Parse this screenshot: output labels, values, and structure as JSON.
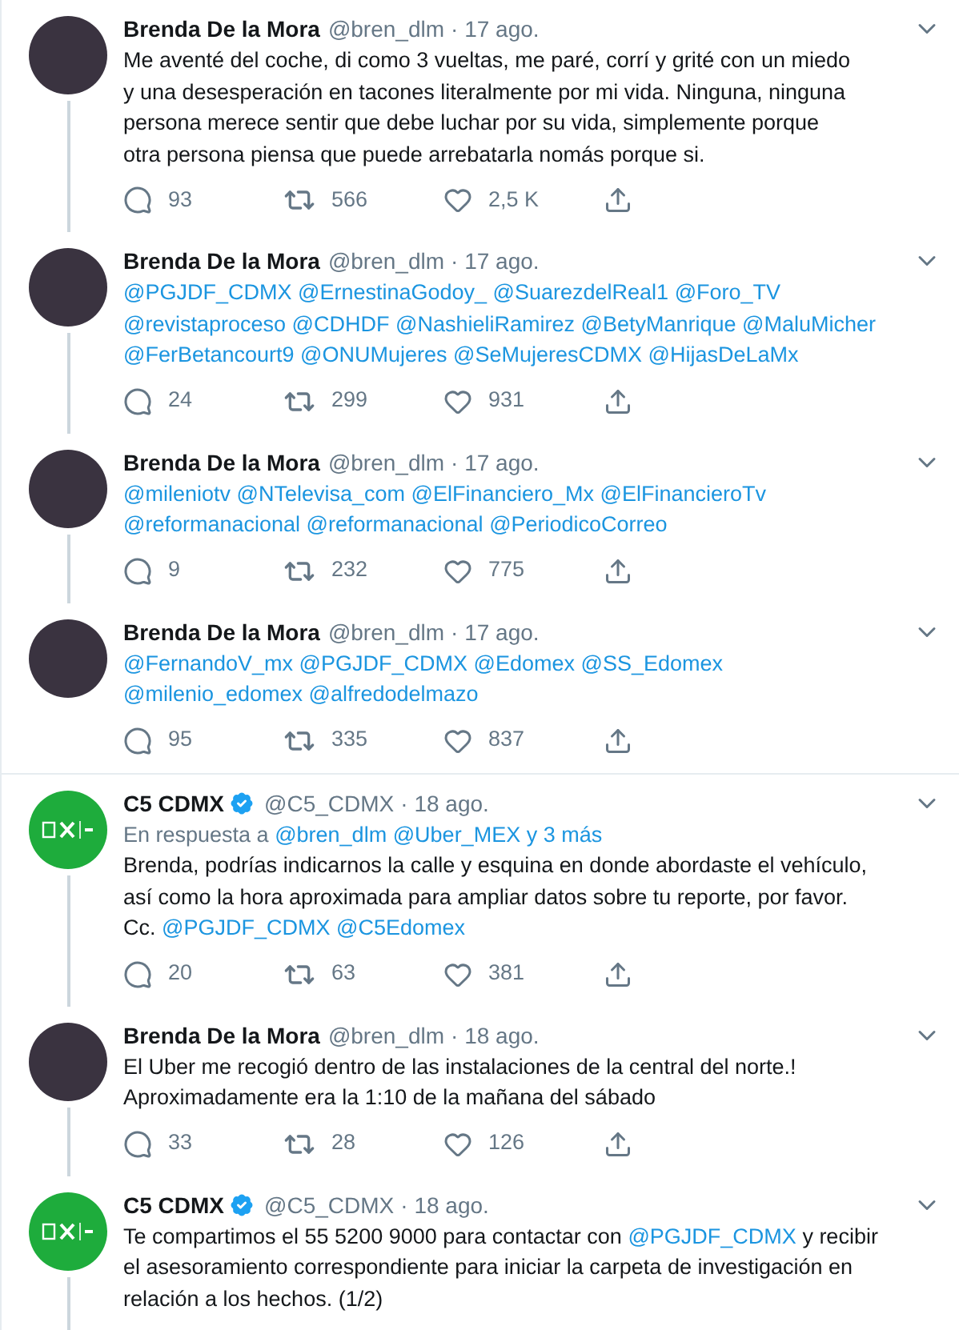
{
  "tweets": [
    {
      "logo": false,
      "name": "Brenda De la Mora",
      "verified": false,
      "handle": "@bren_dlm",
      "date": "· 17 ago.",
      "thread_line": true,
      "divider_below": false,
      "lines": [
        [
          {
            "kind": "text",
            "text": "Me aventé del coche, di como 3 vueltas, me paré, corrí y grité con un miedo"
          }
        ],
        [
          {
            "kind": "text",
            "text": "y una desesperación en tacones literalmente por mi vida. Ninguna, ninguna"
          }
        ],
        [
          {
            "kind": "text",
            "text": "persona merece sentir que debe luchar por su vida, simplemente porque"
          }
        ],
        [
          {
            "kind": "text",
            "text": "otra persona piensa que puede arrebatarla nomás porque si."
          }
        ]
      ],
      "replies": "93",
      "retweets": "566",
      "likes": "2,5 K"
    },
    {
      "logo": false,
      "name": "Brenda De la Mora",
      "verified": false,
      "handle": "@bren_dlm",
      "date": "· 17 ago.",
      "thread_line": true,
      "divider_below": false,
      "lines": [
        [
          {
            "kind": "mention",
            "text": "@PGJDF_CDMX"
          },
          {
            "kind": "mention",
            "text": "@ErnestinaGodoy_"
          },
          {
            "kind": "mention",
            "text": "@SuarezdelReal1"
          },
          {
            "kind": "mention",
            "text": "@Foro_TV"
          }
        ],
        [
          {
            "kind": "mention",
            "text": "@revistaproceso"
          },
          {
            "kind": "mention",
            "text": "@CDHDF"
          },
          {
            "kind": "mention",
            "text": "@NashieliRamirez"
          },
          {
            "kind": "mention",
            "text": "@BetyManrique"
          },
          {
            "kind": "mention",
            "text": "@MaluMicher"
          }
        ],
        [
          {
            "kind": "mention",
            "text": "@FerBetancourt9"
          },
          {
            "kind": "mention",
            "text": "@ONUMujeres"
          },
          {
            "kind": "mention",
            "text": "@SeMujeresCDMX"
          },
          {
            "kind": "mention",
            "text": "@HijasDeLaMx"
          }
        ]
      ],
      "replies": "24",
      "retweets": "299",
      "likes": "931"
    },
    {
      "logo": false,
      "name": "Brenda De la Mora",
      "verified": false,
      "handle": "@bren_dlm",
      "date": "· 17 ago.",
      "thread_line": true,
      "divider_below": false,
      "lines": [
        [
          {
            "kind": "mention",
            "text": "@mileniotv"
          },
          {
            "kind": "mention",
            "text": "@NTelevisa_com"
          },
          {
            "kind": "mention",
            "text": "@ElFinanciero_Mx"
          },
          {
            "kind": "mention",
            "text": "@ElFinancieroTv"
          }
        ],
        [
          {
            "kind": "mention",
            "text": "@reformanacional"
          },
          {
            "kind": "mention",
            "text": "@reformanacional"
          },
          {
            "kind": "mention",
            "text": "@PeriodicoCorreo"
          }
        ]
      ],
      "replies": "9",
      "retweets": "232",
      "likes": "775"
    },
    {
      "logo": false,
      "name": "Brenda De la Mora",
      "verified": false,
      "handle": "@bren_dlm",
      "date": "· 17 ago.",
      "thread_line": false,
      "divider_below": true,
      "lines": [
        [
          {
            "kind": "mention",
            "text": "@FernandoV_mx"
          },
          {
            "kind": "mention",
            "text": "@PGJDF_CDMX"
          },
          {
            "kind": "mention",
            "text": "@Edomex"
          },
          {
            "kind": "mention",
            "text": "@SS_Edomex"
          }
        ],
        [
          {
            "kind": "mention",
            "text": "@milenio_edomex"
          },
          {
            "kind": "mention",
            "text": "@alfredodelmazo"
          }
        ]
      ],
      "replies": "95",
      "retweets": "335",
      "likes": "837"
    },
    {
      "logo": true,
      "name": "C5 CDMX",
      "verified": true,
      "handle": "@C5_CDMX",
      "date": "· 18 ago.",
      "thread_line": true,
      "divider_below": false,
      "reply_to": [
        {
          "kind": "text",
          "text": "En respuesta a"
        },
        {
          "kind": "mention",
          "text": "@bren_dlm"
        },
        {
          "kind": "mention",
          "text": "@Uber_MEX"
        },
        {
          "kind": "mention",
          "text": "y 3 más"
        }
      ],
      "lines": [
        [
          {
            "kind": "text",
            "text": "Brenda, podrías indicarnos la calle y esquina en donde abordaste el vehículo,"
          }
        ],
        [
          {
            "kind": "text",
            "text": "así como la hora aproximada para ampliar datos sobre tu reporte, por favor."
          }
        ],
        [
          {
            "kind": "text",
            "text": "Cc."
          },
          {
            "kind": "mention",
            "text": "@PGJDF_CDMX"
          },
          {
            "kind": "mention",
            "text": "@C5Edomex"
          }
        ]
      ],
      "replies": "20",
      "retweets": "63",
      "likes": "381"
    },
    {
      "logo": false,
      "name": "Brenda De la Mora",
      "verified": false,
      "handle": "@bren_dlm",
      "date": "· 18 ago.",
      "thread_line": true,
      "divider_below": false,
      "lines": [
        [
          {
            "kind": "text",
            "text": "El Uber me recogió dentro de las instalaciones de la central del norte.!"
          }
        ],
        [
          {
            "kind": "text",
            "text": "Aproximadamente era la 1:10 de la mañana del sábado"
          }
        ]
      ],
      "replies": "33",
      "retweets": "28",
      "likes": "126"
    },
    {
      "logo": true,
      "name": "C5 CDMX",
      "verified": true,
      "handle": "@C5_CDMX",
      "date": "· 18 ago.",
      "thread_line": true,
      "divider_below": false,
      "lines": [
        [
          {
            "kind": "text",
            "text": "Te compartimos el 55 5200 9000 para contactar con"
          },
          {
            "kind": "mention",
            "text": "@PGJDF_CDMX"
          },
          {
            "kind": "text",
            "text": "y recibir"
          }
        ],
        [
          {
            "kind": "text",
            "text": "el asesoramiento correspondiente para iniciar la carpeta de investigación en"
          }
        ],
        [
          {
            "kind": "text",
            "text": "relación a los hechos. (1/2)"
          }
        ]
      ]
    }
  ]
}
